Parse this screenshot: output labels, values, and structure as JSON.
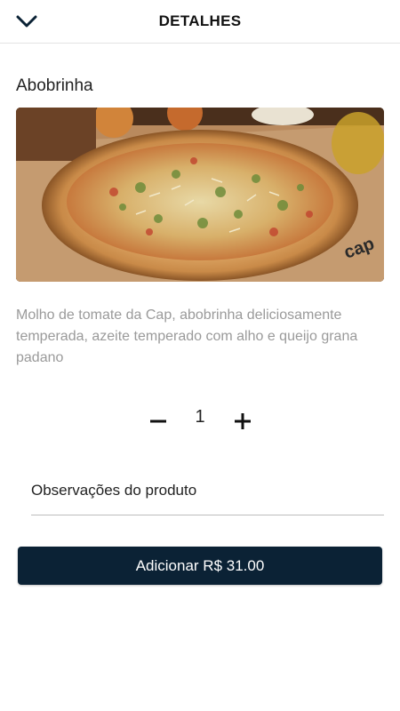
{
  "header": {
    "title": "DETALHES",
    "back_icon": "chevron-down-icon"
  },
  "product": {
    "name": "Abobrinha",
    "description": "Molho de tomate da Cap, abobrinha deliciosamente temperada, azeite temperado com alho e queijo grana padano",
    "image_alt": "Abobrinha"
  },
  "quantity": {
    "value": "1",
    "minus_icon": "minus-icon",
    "plus_icon": "plus-icon"
  },
  "notes": {
    "placeholder": "Observações do produto",
    "value": ""
  },
  "actions": {
    "add_label": "Adicionar R$ 31.00"
  },
  "colors": {
    "button_bg": "#0b2235",
    "description_text": "#9a9a9a"
  }
}
